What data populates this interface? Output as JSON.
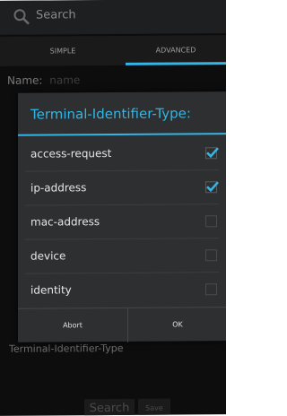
{
  "search": {
    "label": "Search"
  },
  "tabs": [
    {
      "label": "SIMPLE",
      "active": false
    },
    {
      "label": "ADVANCED",
      "active": true
    }
  ],
  "form": {
    "name_label": "Name:",
    "name_placeholder": "name",
    "field_label": "Terminal-Identifier-Type",
    "search_button": "Search",
    "save_button": "Save"
  },
  "dialog": {
    "title": "Terminal-Identifier-Type:",
    "options": [
      {
        "label": "access-request",
        "checked": true
      },
      {
        "label": "ip-address",
        "checked": true
      },
      {
        "label": "mac-address",
        "checked": false
      },
      {
        "label": "device",
        "checked": false
      },
      {
        "label": "identity",
        "checked": false
      }
    ],
    "abort_label": "Abort",
    "ok_label": "OK"
  },
  "colors": {
    "accent": "#33b5e5",
    "background": "#0d0d0d",
    "dialog": "#2d2f31"
  }
}
